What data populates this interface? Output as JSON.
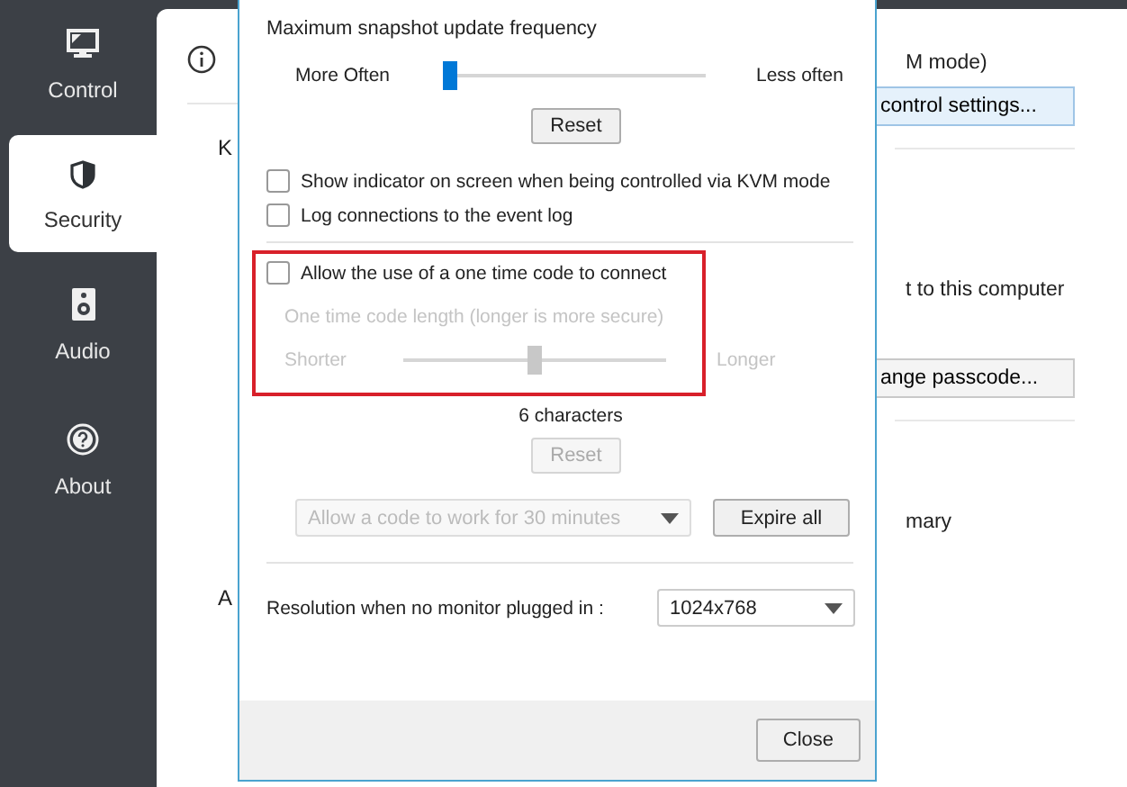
{
  "sidebar": {
    "items": [
      {
        "label": "Control",
        "selected": false
      },
      {
        "label": "Security",
        "selected": true
      },
      {
        "label": "Audio",
        "selected": false
      },
      {
        "label": "About",
        "selected": false
      }
    ]
  },
  "background_panel": {
    "left_fragments": [
      "K",
      "A"
    ],
    "right_fragments": [
      {
        "kind": "text",
        "text": "M mode)"
      },
      {
        "kind": "button",
        "text": "control settings..."
      },
      {
        "kind": "text",
        "text": "t to this computer"
      },
      {
        "kind": "button",
        "text": "ange passcode..."
      },
      {
        "kind": "text",
        "text": "mary"
      }
    ]
  },
  "dialog": {
    "frequency": {
      "title": "Maximum snapshot update frequency",
      "min_label": "More Often",
      "max_label": "Less often",
      "level": 0,
      "reset": "Reset"
    },
    "options": [
      {
        "label": "Show indicator on screen when being controlled via KVM mode",
        "checked": false
      },
      {
        "label": "Log connections to the event log",
        "checked": false
      }
    ],
    "one_time_code": {
      "label": "Allow the use of a one time code to connect",
      "checked": false,
      "disabled": true,
      "length_title": "One time code length (longer is more secure)",
      "min_label": "Shorter",
      "max_label": "Longer",
      "level": 0.5,
      "reading": "6 characters",
      "reset": "Reset",
      "duration": "Allow a code to work for 30 minutes",
      "expire": "Expire all"
    },
    "resolution": {
      "label": "Resolution when no monitor plugged in :",
      "value": "1024x768"
    },
    "buttons": [
      "Close"
    ]
  }
}
